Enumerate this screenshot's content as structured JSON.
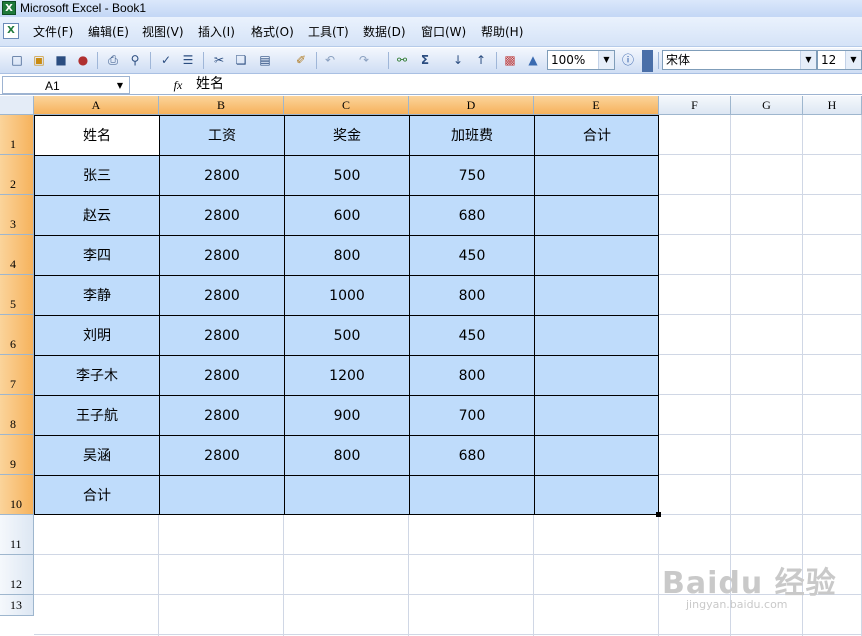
{
  "app": {
    "title": "Microsoft Excel - Book1",
    "icon_label": "X"
  },
  "menus": [
    {
      "label": "文件(F)"
    },
    {
      "label": "编辑(E)"
    },
    {
      "label": "视图(V)"
    },
    {
      "label": "插入(I)"
    },
    {
      "label": "格式(O)"
    },
    {
      "label": "工具(T)"
    },
    {
      "label": "数据(D)"
    },
    {
      "label": "窗口(W)"
    },
    {
      "label": "帮助(H)"
    }
  ],
  "toolbar": {
    "zoom": "100%",
    "font_name": "宋体",
    "font_size": "12",
    "icons": [
      "new-icon",
      "open-icon",
      "save-icon",
      "permission-icon",
      "print-icon",
      "print-preview-icon",
      "spelling-icon",
      "research-icon",
      "cut-icon",
      "copy-icon",
      "paste-icon",
      "format-painter-icon",
      "undo-icon",
      "redo-icon",
      "hyperlink-icon",
      "autosum-icon",
      "sort-ascending-icon",
      "sort-descending-icon",
      "chart-wizard-icon",
      "drawing-icon",
      "help-icon"
    ]
  },
  "formula_bar": {
    "name_box": "A1",
    "fx_label": "fx",
    "content": "姓名"
  },
  "columns": [
    "A",
    "B",
    "C",
    "D",
    "E",
    "F",
    "G",
    "H"
  ],
  "rows": [
    "1",
    "2",
    "3",
    "4",
    "5",
    "6",
    "7",
    "8",
    "9",
    "10",
    "11",
    "12",
    "13"
  ],
  "table": {
    "headers": [
      "姓名",
      "工资",
      "奖金",
      "加班费",
      "合计"
    ],
    "rows": [
      [
        "张三",
        "2800",
        "500",
        "750",
        ""
      ],
      [
        "赵云",
        "2800",
        "600",
        "680",
        ""
      ],
      [
        "李四",
        "2800",
        "800",
        "450",
        ""
      ],
      [
        "李静",
        "2800",
        "1000",
        "800",
        ""
      ],
      [
        "刘明",
        "2800",
        "500",
        "450",
        ""
      ],
      [
        "李子木",
        "2800",
        "1200",
        "800",
        ""
      ],
      [
        "王子航",
        "2800",
        "900",
        "700",
        ""
      ],
      [
        "吴涵",
        "2800",
        "800",
        "680",
        ""
      ],
      [
        "合计",
        "",
        "",
        "",
        ""
      ]
    ]
  },
  "colors": {
    "selection_fill": "#bfdcfb",
    "header_selected": "#f6b25c"
  },
  "watermark": {
    "main": "Baidu 经验",
    "sub": "jingyan.baidu.com"
  }
}
